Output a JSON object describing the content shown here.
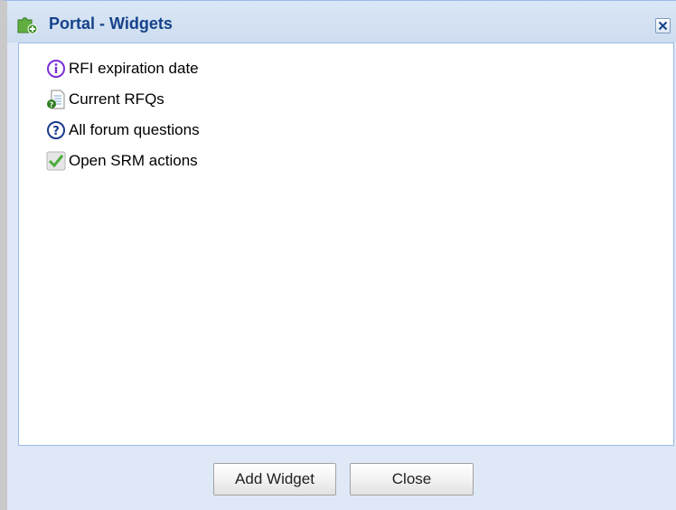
{
  "dialog": {
    "title": "Portal - Widgets",
    "title_icon": "puzzle-add-icon",
    "close_icon": "close-icon"
  },
  "widgets": [
    {
      "label": "RFI expiration date",
      "icon": "info-icon"
    },
    {
      "label": "Current RFQs",
      "icon": "document-question-icon"
    },
    {
      "label": "All forum questions",
      "icon": "question-icon"
    },
    {
      "label": "Open SRM actions",
      "icon": "checkmark-icon"
    }
  ],
  "buttons": {
    "add_label": "Add Widget",
    "close_label": "Close"
  },
  "colors": {
    "title_text": "#15428b",
    "window_bg": "#dfe8f6",
    "border": "#99bbe8"
  }
}
